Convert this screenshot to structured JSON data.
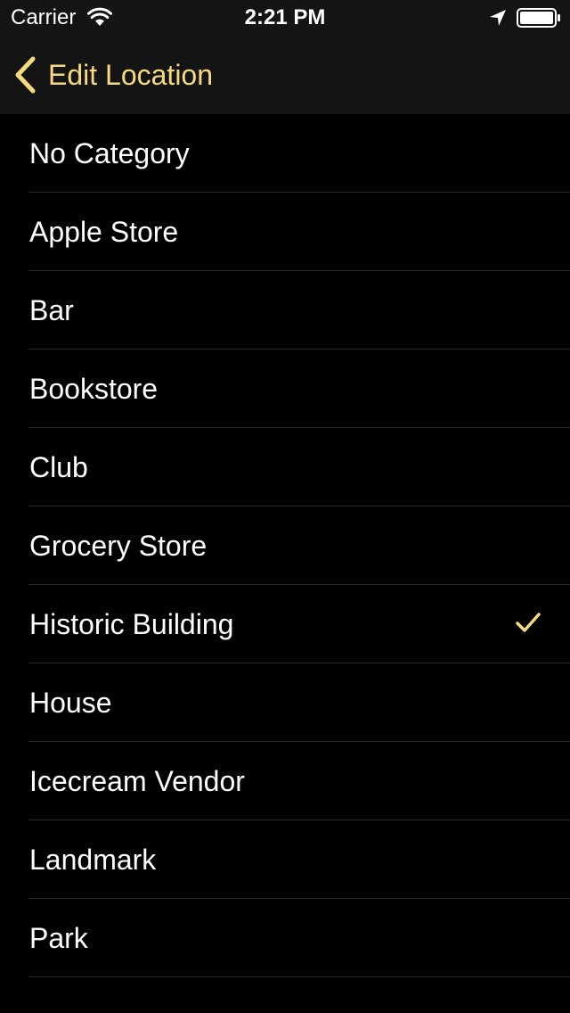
{
  "status_bar": {
    "carrier": "Carrier",
    "time": "2:21 PM"
  },
  "nav": {
    "back_label": "Edit Location"
  },
  "colors": {
    "accent": "#f6da7e",
    "background": "#000000",
    "bar_background": "#141414",
    "separator": "#2a2a2a"
  },
  "categories": {
    "selected": "Historic Building",
    "items": [
      {
        "label": "No Category",
        "checked": false
      },
      {
        "label": "Apple Store",
        "checked": false
      },
      {
        "label": "Bar",
        "checked": false
      },
      {
        "label": "Bookstore",
        "checked": false
      },
      {
        "label": "Club",
        "checked": false
      },
      {
        "label": "Grocery Store",
        "checked": false
      },
      {
        "label": "Historic Building",
        "checked": true
      },
      {
        "label": "House",
        "checked": false
      },
      {
        "label": "Icecream Vendor",
        "checked": false
      },
      {
        "label": "Landmark",
        "checked": false
      },
      {
        "label": "Park",
        "checked": false
      }
    ]
  },
  "icons": {
    "wifi": "wifi-icon",
    "location": "location-arrow-icon",
    "battery": "battery-icon",
    "back": "chevron-left-icon",
    "check": "checkmark-icon"
  }
}
